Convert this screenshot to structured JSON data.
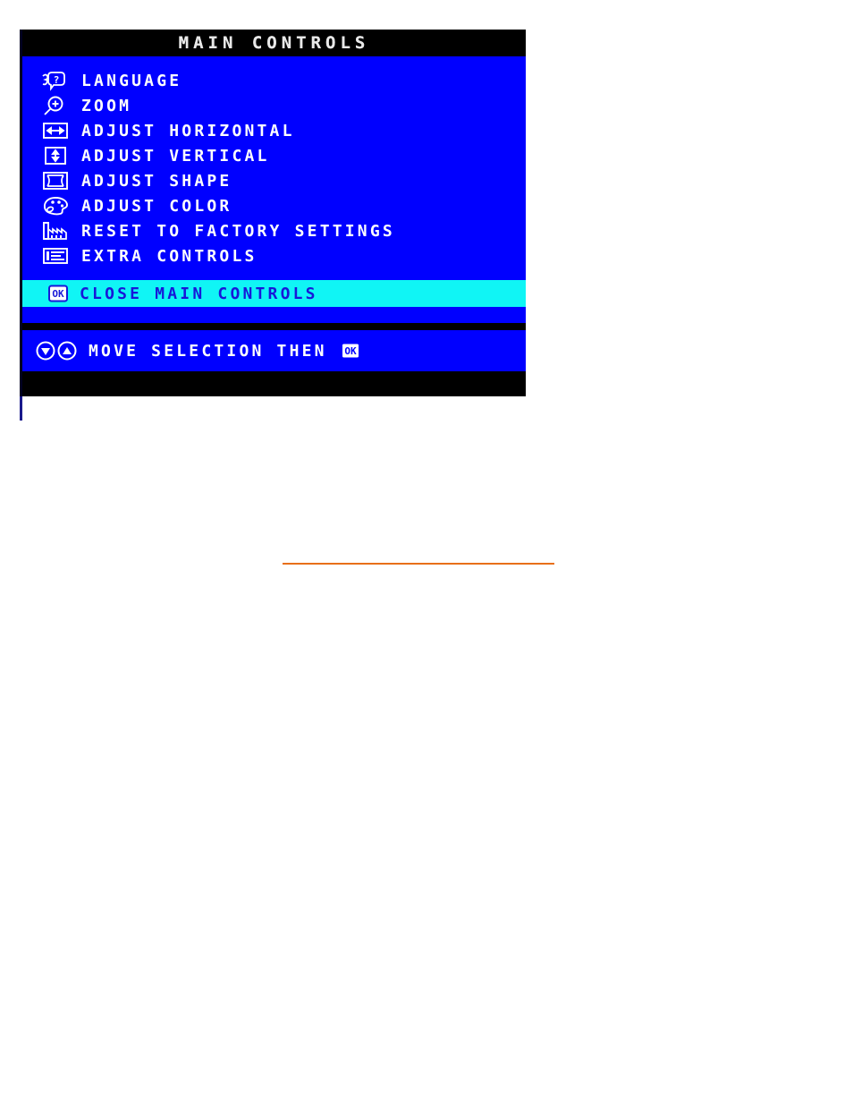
{
  "osd": {
    "title": "MAIN CONTROLS",
    "menu_items": [
      {
        "label": "LANGUAGE",
        "icon": "head-question-bubble-icon"
      },
      {
        "label": "ZOOM",
        "icon": "magnifier-plus-icon"
      },
      {
        "label": "ADJUST HORIZONTAL",
        "icon": "horizontal-arrow-box-icon"
      },
      {
        "label": "ADJUST VERTICAL",
        "icon": "vertical-arrow-box-icon"
      },
      {
        "label": "ADJUST SHAPE",
        "icon": "pincushion-shape-icon"
      },
      {
        "label": "ADJUST COLOR",
        "icon": "color-palette-icon"
      },
      {
        "label": "RESET TO FACTORY SETTINGS",
        "icon": "factory-icon"
      },
      {
        "label": "EXTRA CONTROLS",
        "icon": "list-document-icon"
      }
    ],
    "highlighted_item": {
      "label": "CLOSE MAIN CONTROLS",
      "icon": "ok-button-icon"
    },
    "footer": {
      "label": "MOVE SELECTION THEN",
      "left_icon": "down-arrow-circle-icon",
      "left_icon_2": "up-arrow-circle-icon",
      "trailing_icon": "ok-button-icon"
    },
    "colors": {
      "background_blue": "#0000FF",
      "highlight_cyan": "#10F5F5",
      "title_bar_black": "#000000",
      "text_white": "#FFFFFF",
      "highlight_text_blue": "#1818D8",
      "rule_orange": "#E8701A"
    }
  }
}
